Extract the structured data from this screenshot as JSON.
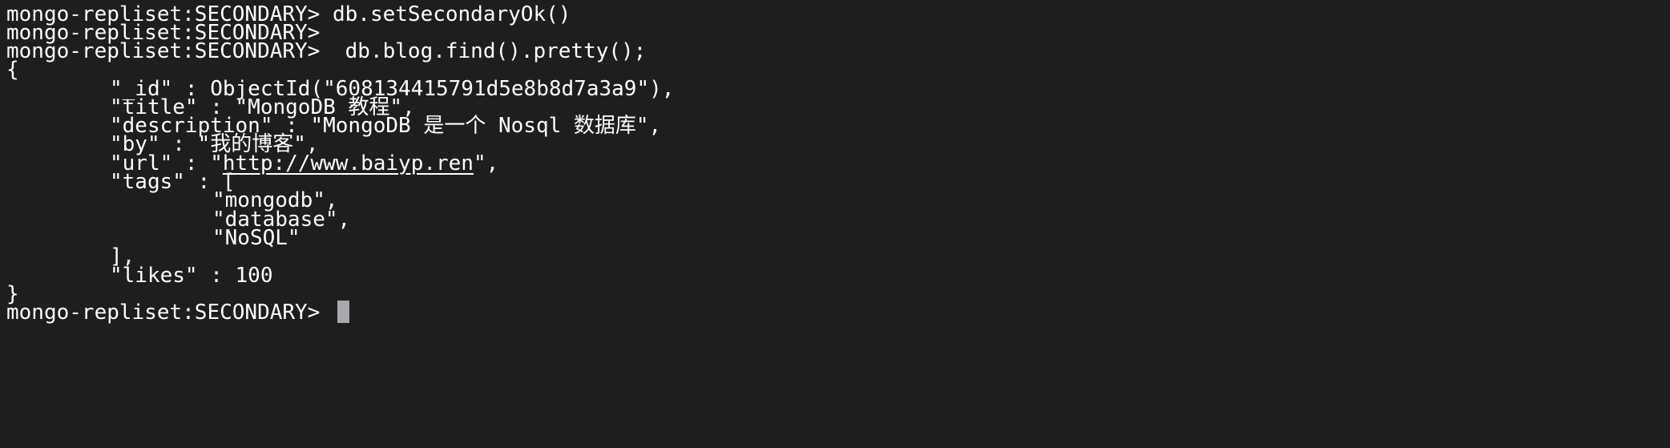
{
  "terminal": {
    "prompt": "mongo-repliset:SECONDARY> ",
    "commands": {
      "set_secondary_ok": "db.setSecondaryOk()",
      "empty": "",
      "find": " db.blog.find().pretty();"
    },
    "document": {
      "open_brace": "{",
      "id_line": "\"_id\" : ObjectId(\"608134415791d5e8b8d7a3a9\"),",
      "title_line": "\"title\" : \"MongoDB 教程\",",
      "description_line": "\"description\" : \"MongoDB 是一个 Nosql 数据库\",",
      "by_line": "\"by\" : \"我的博客\",",
      "url_prefix": "\"url\" : \"",
      "url_value": "http://www.baiyp.ren",
      "url_suffix": "\",",
      "tags_open": "\"tags\" : [",
      "tags": [
        "\"mongodb\",",
        "\"database\",",
        "\"NoSQL\""
      ],
      "tags_close": "],",
      "likes_line": "\"likes\" : 100",
      "close_brace": "}"
    }
  },
  "colors": {
    "background": "#1e1e1e",
    "foreground": "#ffffff",
    "cursor": "#a8a8b0"
  }
}
